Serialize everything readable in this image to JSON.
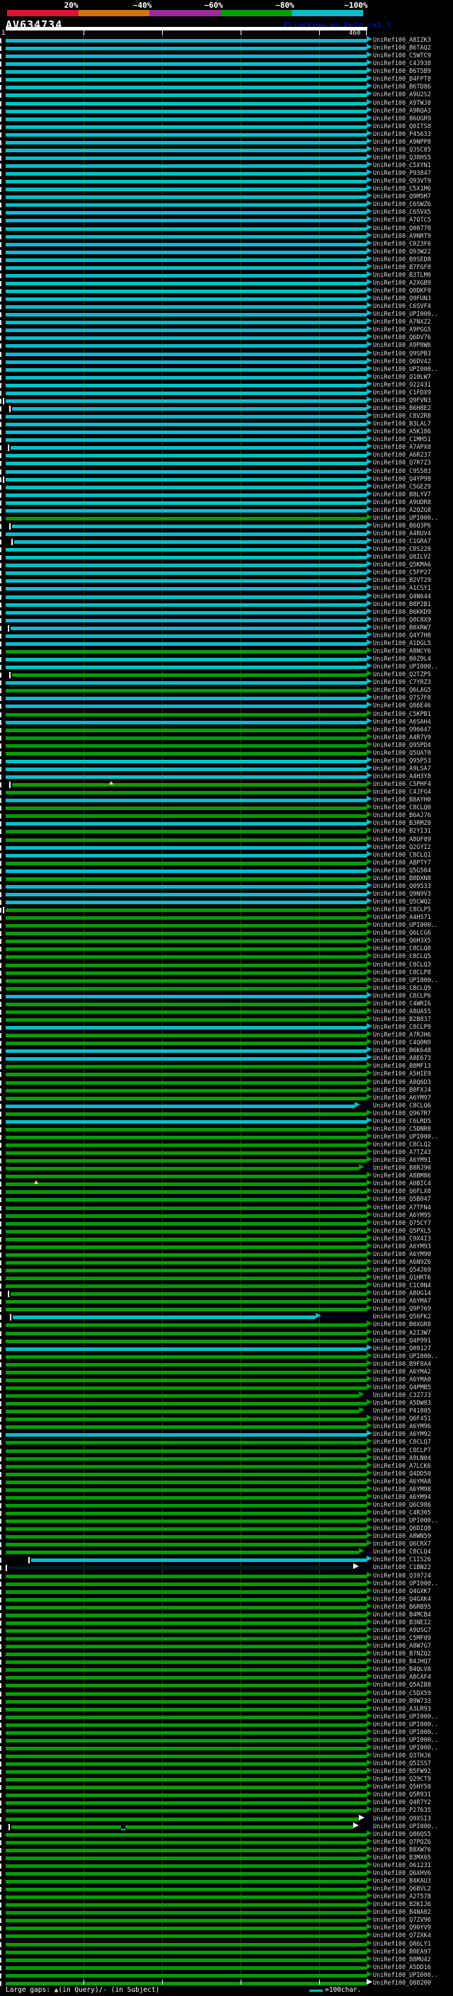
{
  "header": {
    "title": "AV634734",
    "watermark": "AlignView.pm Beta re1.7",
    "key": {
      "segments": [
        {
          "label": "20%",
          "color": "#ea0f2f"
        },
        {
          "label": "~40%",
          "color": "#d4720c"
        },
        {
          "label": "~60%",
          "color": "#9d2ba0"
        },
        {
          "label": "~80%",
          "color": "#00a000"
        },
        {
          "label": "~100%",
          "color": "#00bccb"
        }
      ]
    },
    "scale": {
      "start_label": "1",
      "end_label": "460",
      "tick_chars": [
        100,
        200,
        300,
        400
      ]
    }
  },
  "footer": {
    "large_gaps_text": "Large gaps:",
    "query_gap_symbol": "▲",
    "query_gap_text": "(in Query)/",
    "subject_gap_symbol": "-",
    "subject_gap_text": " (in Subject)",
    "scale_legend_text": "=100char."
  },
  "colors": {
    "cyan": "#00c0cc",
    "green": "#009e00",
    "dark": "#041428",
    "white": "#ffffff",
    "connector": "#000060",
    "grid": "#3c3c04"
  },
  "chart_data": {
    "type": "bar",
    "orientation": "horizontal-alignment-plot",
    "title": "AV634734",
    "x_range": [
      1,
      460
    ],
    "x_ticks": [
      1,
      100,
      200,
      300,
      400,
      460
    ],
    "legend": [
      "20%",
      "~40%",
      "~60%",
      "~80%",
      "~100%"
    ],
    "note": "c=cyan(~100% bin), g=green(~80% bin), n=dark; s/e=alignment span in query chars; t=start tick; aw=white arrowhead; gq=query gap marker; gs=subject gap marker",
    "rows": [
      {
        "l": "UniRef100_A8IZK3",
        "c": "c"
      },
      {
        "l": "UniRef100_B6TAQ2",
        "c": "c"
      },
      {
        "l": "UniRef100_C5WTC9",
        "c": "c"
      },
      {
        "l": "UniRef100_C4J938",
        "c": "c"
      },
      {
        "l": "UniRef100_B6T5B9",
        "c": "c"
      },
      {
        "l": "UniRef100_B4FPT8",
        "c": "c"
      },
      {
        "l": "UniRef100_B6TD86",
        "c": "c"
      },
      {
        "l": "UniRef100_A9U2S2",
        "c": "c"
      },
      {
        "l": "UniRef100_A9TWJ0",
        "c": "c"
      },
      {
        "l": "UniRef100_A9RQA3",
        "c": "c"
      },
      {
        "l": "UniRef100_B6UGR9",
        "c": "c"
      },
      {
        "l": "UniRef100_Q0ITS8",
        "c": "c"
      },
      {
        "l": "UniRef100_P45633",
        "c": "c"
      },
      {
        "l": "UniRef100_A9NPP8",
        "c": "c"
      },
      {
        "l": "UniRef100_Q3SC85",
        "c": "c"
      },
      {
        "l": "UniRef100_Q38HS5",
        "c": "c"
      },
      {
        "l": "UniRef100_C5XYN1",
        "c": "c"
      },
      {
        "l": "UniRef100_P93847",
        "c": "c"
      },
      {
        "l": "UniRef100_Q93VT9",
        "c": "c"
      },
      {
        "l": "UniRef100_C5X1M6",
        "c": "c"
      },
      {
        "l": "UniRef100_Q9M5M7",
        "c": "c"
      },
      {
        "l": "UniRef100_C6SWZ6",
        "c": "c"
      },
      {
        "l": "UniRef100_C6SVX5",
        "c": "c"
      },
      {
        "l": "UniRef100_A7QTC5",
        "c": "c"
      },
      {
        "l": "UniRef100_Q08770",
        "c": "c"
      },
      {
        "l": "UniRef100_A9NRT9",
        "c": "c"
      },
      {
        "l": "UniRef100_C0Z3F6",
        "c": "c"
      },
      {
        "l": "UniRef100_Q93W22",
        "c": "c"
      },
      {
        "l": "UniRef100_B9SED8",
        "c": "c"
      },
      {
        "l": "UniRef100_B7FGF8",
        "c": "c"
      },
      {
        "l": "UniRef100_B3TLM0",
        "c": "c"
      },
      {
        "l": "UniRef100_A2XGB9",
        "c": "c"
      },
      {
        "l": "UniRef100_Q0DKF0",
        "c": "c"
      },
      {
        "l": "UniRef100_Q9FUN3",
        "c": "c"
      },
      {
        "l": "UniRef100_C6SVF4",
        "c": "c"
      },
      {
        "l": "UniRef100_UPI000..",
        "c": "c"
      },
      {
        "l": "UniRef100_A7NXZ2",
        "c": "c"
      },
      {
        "l": "UniRef100_A9PGG5",
        "c": "c"
      },
      {
        "l": "UniRef100_Q6DV76",
        "c": "c"
      },
      {
        "l": "UniRef100_A9P8W6",
        "c": "c"
      },
      {
        "l": "UniRef100_Q9SPB3",
        "c": "c"
      },
      {
        "l": "UniRef100_Q6DV42",
        "c": "c"
      },
      {
        "l": "UniRef100_UPI000..",
        "c": "c"
      },
      {
        "l": "UniRef100_Q10LW7",
        "c": "c"
      },
      {
        "l": "UniRef100_O22431",
        "c": "c"
      },
      {
        "l": "UniRef100_C1FDX9",
        "c": "c"
      },
      {
        "l": "UniRef100_Q9FVN3",
        "c": "c",
        "t": 1
      },
      {
        "l": "UniRef100_B6H8E2",
        "c": "c",
        "t": 1,
        "s": 9
      },
      {
        "l": "UniRef100_C8V2R8",
        "c": "c"
      },
      {
        "l": "UniRef100_B3LAL7",
        "c": "c"
      },
      {
        "l": "UniRef100_A5K186",
        "c": "c"
      },
      {
        "l": "UniRef100_C1MH51",
        "c": "c"
      },
      {
        "l": "UniRef100_A7APX0",
        "c": "c",
        "t": 1,
        "s": 7
      },
      {
        "l": "UniRef100_A6R237",
        "c": "c"
      },
      {
        "l": "UniRef100_Q7R7Z3",
        "c": "c"
      },
      {
        "l": "UniRef100_C9S583",
        "c": "c"
      },
      {
        "l": "UniRef100_Q4YP98",
        "c": "c",
        "t": 1
      },
      {
        "l": "UniRef100_C5GEZ9",
        "c": "c"
      },
      {
        "l": "UniRef100_B8LYV7",
        "c": "c"
      },
      {
        "l": "UniRef100_A9UDR8",
        "c": "c"
      },
      {
        "l": "UniRef100_A2QZG8",
        "c": "c"
      },
      {
        "l": "UniRef100_UPI000..",
        "c": "g"
      },
      {
        "l": "UniRef100_B6Q3P6",
        "c": "c",
        "t": 1,
        "s": 9
      },
      {
        "l": "UniRef100_A4RUV4",
        "c": "c"
      },
      {
        "l": "UniRef100_C1GRA7",
        "c": "c",
        "t": 1,
        "s": 12
      },
      {
        "l": "UniRef100_C0S220",
        "c": "c"
      },
      {
        "l": "UniRef100_Q8ILV2",
        "c": "c"
      },
      {
        "l": "UniRef100_Q5KMA6",
        "c": "c"
      },
      {
        "l": "UniRef100_C5FP27",
        "c": "c"
      },
      {
        "l": "UniRef100_B2VT29",
        "c": "c"
      },
      {
        "l": "UniRef100_A1CSY1",
        "c": "c"
      },
      {
        "l": "UniRef100_Q4N644",
        "c": "c"
      },
      {
        "l": "UniRef100_B8P2B1",
        "c": "c"
      },
      {
        "l": "UniRef100_B6KKD9",
        "c": "c"
      },
      {
        "l": "UniRef100_Q0C8X9",
        "c": "c"
      },
      {
        "l": "UniRef100_B0XRW7",
        "c": "c",
        "t": 1,
        "s": 7
      },
      {
        "l": "UniRef100_Q4Y7H8",
        "c": "c"
      },
      {
        "l": "UniRef100_A1DGL5",
        "c": "c"
      },
      {
        "l": "UniRef100_A8NCY6",
        "c": "g"
      },
      {
        "l": "UniRef100_B0Z9L4",
        "c": "c"
      },
      {
        "l": "UniRef100_UPI000..",
        "c": "c"
      },
      {
        "l": "UniRef100_Q2TZP5",
        "c": "g",
        "t": 1,
        "s": 9
      },
      {
        "l": "UniRef100_C7YRZ3",
        "c": "c"
      },
      {
        "l": "UniRef100_Q6LAG5",
        "c": "g"
      },
      {
        "l": "UniRef100_Q7S7F0",
        "c": "c"
      },
      {
        "l": "UniRef100_Q86E46",
        "c": "c"
      },
      {
        "l": "UniRef100_C5KPB1",
        "c": "g"
      },
      {
        "l": "UniRef100_A6SAH4",
        "c": "c"
      },
      {
        "l": "UniRef100_O96647",
        "c": "g"
      },
      {
        "l": "UniRef100_A4R7V9",
        "c": "g"
      },
      {
        "l": "UniRef100_Q95PD4",
        "c": "g"
      },
      {
        "l": "UniRef100_Q5UAT0",
        "c": "g"
      },
      {
        "l": "UniRef100_Q95P53",
        "c": "c"
      },
      {
        "l": "UniRef100_A9LSA7",
        "c": "c"
      },
      {
        "l": "UniRef100_A4H3Y8",
        "c": "c"
      },
      {
        "l": "UniRef100_C5PHF4",
        "c": "g",
        "t": 1,
        "s": 9,
        "gq": 135
      },
      {
        "l": "UniRef100_C4JFG4",
        "c": "g"
      },
      {
        "l": "UniRef100_B8AYH0",
        "c": "c"
      },
      {
        "l": "UniRef100_C8CLQ0",
        "c": "g"
      },
      {
        "l": "UniRef100_B6AJ76",
        "c": "g"
      },
      {
        "l": "UniRef100_B3RMZ0",
        "c": "c"
      },
      {
        "l": "UniRef100_B2YI31",
        "c": "g"
      },
      {
        "l": "UniRef100_A8UF09",
        "c": "g"
      },
      {
        "l": "UniRef100_Q2GYI2",
        "c": "c"
      },
      {
        "l": "UniRef100_C8CLQ1",
        "c": "c"
      },
      {
        "l": "UniRef100_A8PTY7",
        "c": "g"
      },
      {
        "l": "UniRef100_Q5G584",
        "c": "c"
      },
      {
        "l": "UniRef100_B0DXN8",
        "c": "g"
      },
      {
        "l": "UniRef100_Q09533",
        "c": "c"
      },
      {
        "l": "UniRef100_Q9N9V3",
        "c": "c"
      },
      {
        "l": "UniRef100_Q5CWQ2",
        "c": "c"
      },
      {
        "l": "UniRef100_C8CLP5",
        "c": "g",
        "t": 1
      },
      {
        "l": "UniRef100_A4HS71",
        "c": "g"
      },
      {
        "l": "UniRef100_UPI000..",
        "c": "g"
      },
      {
        "l": "UniRef100_Q6LCG6",
        "c": "g"
      },
      {
        "l": "UniRef100_Q6H3X5",
        "c": "g"
      },
      {
        "l": "UniRef100_C8CLQ8",
        "c": "g"
      },
      {
        "l": "UniRef100_C8CLQ5",
        "c": "g"
      },
      {
        "l": "UniRef100_C8CLQ3",
        "c": "g"
      },
      {
        "l": "UniRef100_C8CLP8",
        "c": "g"
      },
      {
        "l": "UniRef100_UPI000..",
        "c": "g"
      },
      {
        "l": "UniRef100_C8CLQ9",
        "c": "g"
      },
      {
        "l": "UniRef100_C8CLP6",
        "c": "c"
      },
      {
        "l": "UniRef100_C4WRI6",
        "c": "g"
      },
      {
        "l": "UniRef100_A8UA55",
        "c": "g"
      },
      {
        "l": "UniRef100_B2B837",
        "c": "g"
      },
      {
        "l": "UniRef100_C8CLP9",
        "c": "c"
      },
      {
        "l": "UniRef100_A7RJH6",
        "c": "g"
      },
      {
        "l": "UniRef100_C4Q0N9",
        "c": "g"
      },
      {
        "l": "UniRef100_B6K648",
        "c": "c"
      },
      {
        "l": "UniRef100_A8E673",
        "c": "c"
      },
      {
        "l": "UniRef100_B8MF13",
        "c": "g"
      },
      {
        "l": "UniRef100_A5HIE9",
        "c": "g"
      },
      {
        "l": "UniRef100_A8Q6D3",
        "c": "g"
      },
      {
        "l": "UniRef100_B0FXJ4",
        "c": "g"
      },
      {
        "l": "UniRef100_A6YM97",
        "c": "g"
      },
      {
        "l": "UniRef100_C8CLQ6",
        "c": "c",
        "e": 445
      },
      {
        "l": "UniRef100_Q967R7",
        "c": "g"
      },
      {
        "l": "UniRef100_C6LRD5",
        "c": "c"
      },
      {
        "l": "UniRef100_C5DNR0",
        "c": "g"
      },
      {
        "l": "UniRef100_UPI000..",
        "c": "g"
      },
      {
        "l": "UniRef100_C8CLQ2",
        "c": "g"
      },
      {
        "l": "UniRef100_A7TZ43",
        "c": "g"
      },
      {
        "l": "UniRef100_A6YM91",
        "c": "g"
      },
      {
        "l": "UniRef100_B8RJ90",
        "c": "g",
        "e": 450
      },
      {
        "l": "UniRef100_A8BM86",
        "c": "g"
      },
      {
        "l": "UniRef100_A0BIC4",
        "c": "g",
        "gq": 40
      },
      {
        "l": "UniRef100_Q6FLX0",
        "c": "g"
      },
      {
        "l": "UniRef100_Q5B047",
        "c": "g"
      },
      {
        "l": "UniRef100_A7TFN4",
        "c": "g"
      },
      {
        "l": "UniRef100_A6YM95",
        "c": "g"
      },
      {
        "l": "UniRef100_Q75CY7",
        "c": "g"
      },
      {
        "l": "UniRef100_Q5PXL5",
        "c": "g"
      },
      {
        "l": "UniRef100_C9X4I3",
        "c": "g"
      },
      {
        "l": "UniRef100_A6YM93",
        "c": "g"
      },
      {
        "l": "UniRef100_A6YM90",
        "c": "g"
      },
      {
        "l": "UniRef100_A6N9Z6",
        "c": "g"
      },
      {
        "l": "UniRef100_Q54J69",
        "c": "g"
      },
      {
        "l": "UniRef100_Q1HRT6",
        "c": "g"
      },
      {
        "l": "UniRef100_C1C0N4",
        "c": "g"
      },
      {
        "l": "UniRef100_A8UG14",
        "c": "g",
        "t": 1,
        "s": 7
      },
      {
        "l": "UniRef100_A6YMA7",
        "c": "g"
      },
      {
        "l": "UniRef100_Q9P769",
        "c": "g"
      },
      {
        "l": "UniRef100_Q56FK2",
        "c": "c",
        "t": 1,
        "s": 10,
        "e": 395
      },
      {
        "l": "UniRef100_B0XGR8",
        "c": "g"
      },
      {
        "l": "UniRef100_A2I3W7",
        "c": "g"
      },
      {
        "l": "UniRef100_Q4P991",
        "c": "g"
      },
      {
        "l": "UniRef100_Q09127",
        "c": "c"
      },
      {
        "l": "UniRef100_UPI000..",
        "c": "g"
      },
      {
        "l": "UniRef100_B9F8A4",
        "c": "g"
      },
      {
        "l": "UniRef100_A6YMA2",
        "c": "g"
      },
      {
        "l": "UniRef100_A6YMA0",
        "c": "g"
      },
      {
        "l": "UniRef100_Q4PMB5",
        "c": "g"
      },
      {
        "l": "UniRef100_C3Z7J3",
        "c": "g",
        "e": 450
      },
      {
        "l": "UniRef100_A5DW83",
        "c": "g"
      },
      {
        "l": "UniRef100_P41805",
        "c": "g",
        "e": 450
      },
      {
        "l": "UniRef100_Q6F451",
        "c": "g"
      },
      {
        "l": "UniRef100_A6YM96",
        "c": "g"
      },
      {
        "l": "UniRef100_A6YM92",
        "c": "c"
      },
      {
        "l": "UniRef100_C8CLQ7",
        "c": "g"
      },
      {
        "l": "UniRef100_C8CLP7",
        "c": "g"
      },
      {
        "l": "UniRef100_A9LN04",
        "c": "g"
      },
      {
        "l": "UniRef100_A7LCK6",
        "c": "g"
      },
      {
        "l": "UniRef100_Q4DD50",
        "c": "g"
      },
      {
        "l": "UniRef100_A6YMA8",
        "c": "g"
      },
      {
        "l": "UniRef100_A6YM98",
        "c": "g"
      },
      {
        "l": "UniRef100_A6YM94",
        "c": "g"
      },
      {
        "l": "UniRef100_Q6C986",
        "c": "g"
      },
      {
        "l": "UniRef100_C4R305",
        "c": "g"
      },
      {
        "l": "UniRef100_UPI000..",
        "c": "g"
      },
      {
        "l": "UniRef100_Q6DIQ8",
        "c": "g"
      },
      {
        "l": "UniRef100_A8WN59",
        "c": "g"
      },
      {
        "l": "UniRef100_Q6CRX7",
        "c": "g"
      },
      {
        "l": "UniRef100_C8CLQ4",
        "c": "g",
        "e": 450
      },
      {
        "l": "UniRef100_C1IS26",
        "c": "c",
        "t": 1,
        "s": 33
      },
      {
        "l": "UniRef100_C1BN22",
        "c": "n",
        "t": 1,
        "s": 5,
        "e": 443,
        "aw": 1
      },
      {
        "l": "UniRef100_Q39724",
        "c": "g"
      },
      {
        "l": "UniRef100_UPI000..",
        "c": "g"
      },
      {
        "l": "UniRef100_Q4GXK7",
        "c": "g"
      },
      {
        "l": "UniRef100_Q4GXK4",
        "c": "g"
      },
      {
        "l": "UniRef100_B6RB95",
        "c": "g"
      },
      {
        "l": "UniRef100_B4MCB4",
        "c": "g"
      },
      {
        "l": "UniRef100_B3NEI2",
        "c": "g"
      },
      {
        "l": "UniRef100_A9USG7",
        "c": "g"
      },
      {
        "l": "UniRef100_C5MF09",
        "c": "g"
      },
      {
        "l": "UniRef100_A8W7G7",
        "c": "g"
      },
      {
        "l": "UniRef100_B7NZQ2",
        "c": "g"
      },
      {
        "l": "UniRef100_B4JHQ7",
        "c": "g"
      },
      {
        "l": "UniRef100_B4QLV8",
        "c": "g"
      },
      {
        "l": "UniRef100_A8CAF4",
        "c": "g"
      },
      {
        "l": "UniRef100_Q5AIB8",
        "c": "g"
      },
      {
        "l": "UniRef100_C5DX59",
        "c": "g"
      },
      {
        "l": "UniRef100_B9W733",
        "c": "g"
      },
      {
        "l": "UniRef100_A3LR93",
        "c": "g"
      },
      {
        "l": "UniRef100_UPI000..",
        "c": "g"
      },
      {
        "l": "UniRef100_UPI000..",
        "c": "g"
      },
      {
        "l": "UniRef100_UPI000..",
        "c": "g"
      },
      {
        "l": "UniRef100_UPI000..",
        "c": "g"
      },
      {
        "l": "UniRef100_UPI000..",
        "c": "g"
      },
      {
        "l": "UniRef100_Q3THJ6",
        "c": "g"
      },
      {
        "l": "UniRef100_Q5ISS7",
        "c": "g"
      },
      {
        "l": "UniRef100_B5FW92",
        "c": "g"
      },
      {
        "l": "UniRef100_Q29CT9",
        "c": "g"
      },
      {
        "l": "UniRef100_Q5HY50",
        "c": "g"
      },
      {
        "l": "UniRef100_Q5R931",
        "c": "g"
      },
      {
        "l": "UniRef100_Q4R7Y2",
        "c": "g"
      },
      {
        "l": "UniRef100_P27635",
        "c": "g"
      },
      {
        "l": "UniRef100_Q9XSI3",
        "c": "g",
        "e": 450,
        "aw": 1
      },
      {
        "l": "UniRef100_UPI000..",
        "c": "g",
        "t": 1,
        "s": 8,
        "e": 443,
        "aw": 1,
        "gs": 150
      },
      {
        "l": "UniRef100_Q86QS5",
        "c": "g"
      },
      {
        "l": "UniRef100_Q7PQZ6",
        "c": "g"
      },
      {
        "l": "UniRef100_B8XW76",
        "c": "g"
      },
      {
        "l": "UniRef100_B3MX05",
        "c": "g"
      },
      {
        "l": "UniRef100_O61231",
        "c": "g"
      },
      {
        "l": "UniRef100_Q6XHV6",
        "c": "g"
      },
      {
        "l": "UniRef100_B4KAU3",
        "c": "g"
      },
      {
        "l": "UniRef100_Q6BVL2",
        "c": "g"
      },
      {
        "l": "UniRef100_A2T578",
        "c": "g"
      },
      {
        "l": "UniRef100_B2KIJ6",
        "c": "g"
      },
      {
        "l": "UniRef100_B4NA02",
        "c": "g"
      },
      {
        "l": "UniRef100_Q7ZV96",
        "c": "g"
      },
      {
        "l": "UniRef100_Q90YV9",
        "c": "g"
      },
      {
        "l": "UniRef100_Q7ZXK4",
        "c": "g"
      },
      {
        "l": "UniRef100_Q86LY1",
        "c": "g"
      },
      {
        "l": "UniRef100_B0EA97",
        "c": "g"
      },
      {
        "l": "UniRef100_B8MU42",
        "c": "g"
      },
      {
        "l": "UniRef100_A5DD16",
        "c": "g"
      },
      {
        "l": "UniRef100_UPI000..",
        "c": "g"
      },
      {
        "l": "UniRef100_Q08200",
        "c": "g",
        "aw": 1
      }
    ]
  }
}
